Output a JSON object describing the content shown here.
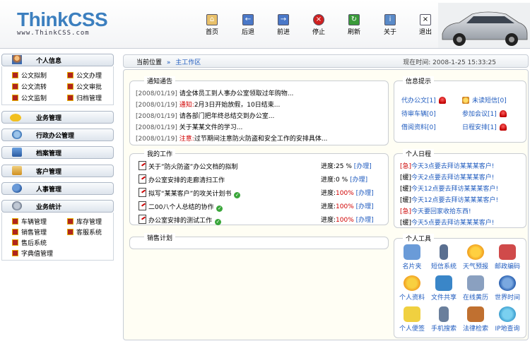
{
  "logo": {
    "main": "ThinkCSS",
    "sub": "www.ThinkCSS.com"
  },
  "toolbar": [
    {
      "label": "首页",
      "icon": "home-icon"
    },
    {
      "label": "后退",
      "icon": "back-arrow-icon"
    },
    {
      "label": "前进",
      "icon": "forward-arrow-icon"
    },
    {
      "label": "停止",
      "icon": "stop-icon"
    },
    {
      "label": "刷新",
      "icon": "refresh-icon"
    },
    {
      "label": "关于",
      "icon": "about-icon"
    },
    {
      "label": "退出",
      "icon": "exit-icon"
    }
  ],
  "sidebar": {
    "personal": {
      "title": "个人信息",
      "items": [
        "公文拟制",
        "公文办理",
        "公文流转",
        "公文审批",
        "公文监制",
        "归档管理"
      ]
    },
    "business": {
      "title": "业务管理"
    },
    "office": {
      "title": "行政办公管理"
    },
    "archive": {
      "title": "档案管理"
    },
    "customer": {
      "title": "客户管理"
    },
    "hr": {
      "title": "人事管理"
    },
    "stats": {
      "title": "业务统计",
      "items": [
        "车辆管理",
        "库存管理",
        "销售管理",
        "客服系统",
        "售后系统",
        "字典值管理"
      ]
    }
  },
  "crumb": {
    "label": "当前位置",
    "sep": "»",
    "current": "主工作区",
    "time_label": "现在时间:",
    "time": "2008-1-25 15:33:25"
  },
  "notice": {
    "title": "通知通告",
    "rows": [
      {
        "date": "[2008/01/19]",
        "flag": "",
        "text": "请全体员工到人事办公室领取过年购物..."
      },
      {
        "date": "[2008/01/19]",
        "flag": "通知:",
        "text": "2月3日开始放假，10日结束..."
      },
      {
        "date": "[2008/01/19]",
        "flag": "",
        "text": "请各部门把年终总结交到办公室..."
      },
      {
        "date": "[2008/01/19]",
        "flag": "",
        "text": "关于某某文件的学习..."
      },
      {
        "date": "[2008/01/19]",
        "flag": "注意:",
        "text": "过节期间注意防火防盗和安全工作的安排具体..."
      }
    ]
  },
  "work": {
    "title": "我的工作",
    "rows": [
      {
        "text": "关于”防火防盗”办公文档的拟制",
        "done": false,
        "progress_label": "进度:",
        "progress": "25 %",
        "action": "[办理]"
      },
      {
        "text": "办公室安排的走廊清扫工作",
        "done": false,
        "progress_label": "进度:",
        "progress": "0 %",
        "action": "[办理]"
      },
      {
        "text": "拟写“某某客户”的攻关计划书",
        "done": true,
        "progress_label": "进度:",
        "progress": "100%",
        "action": "[办理]"
      },
      {
        "text": "二00八个人总结的协作",
        "done": true,
        "progress_label": "进度:",
        "progress": "100%",
        "action": "[办理]"
      },
      {
        "text": "办公室安排的测试工作",
        "done": true,
        "progress_label": "进度:",
        "progress": "100%",
        "action": "[办理]"
      }
    ]
  },
  "sales": {
    "title": "销售计划"
  },
  "tips": {
    "title": "信息提示",
    "items": [
      {
        "label": "代办公文",
        "count": "[1]"
      },
      {
        "label": "未读短信",
        "count": "[0]"
      },
      {
        "label": "待审车辆",
        "count": "[0]"
      },
      {
        "label": "参加会议",
        "count": "[1]"
      },
      {
        "label": "借阅资料",
        "count": "[0]"
      },
      {
        "label": "日程安排",
        "count": "[1]"
      }
    ]
  },
  "schedule": {
    "title": "个人日程",
    "rows": [
      {
        "tag": "[急]",
        "urgent": true,
        "text": "今天3点要去拜访某某某客户!"
      },
      {
        "tag": "[缓]",
        "urgent": false,
        "text": "今天2点要去拜访某某某客户!"
      },
      {
        "tag": "[缓]",
        "urgent": false,
        "text": "今天12点要去拜访某某某客户!"
      },
      {
        "tag": "[缓]",
        "urgent": false,
        "text": "今天12点要去拜访某某某客户!"
      },
      {
        "tag": "[急]",
        "urgent": true,
        "text": "今天要回家收拾东西!"
      },
      {
        "tag": "[缓]",
        "urgent": false,
        "text": "今天5点要去拜访某某某客户!"
      }
    ]
  },
  "tools": {
    "title": "个人工具",
    "items": [
      {
        "label": "名片夹",
        "icon": "card-holder-icon",
        "color": "#6a9bd8"
      },
      {
        "label": "短信系统",
        "icon": "mobile-phone-icon",
        "color": "#5a6f90"
      },
      {
        "label": "天气预报",
        "icon": "weather-icon",
        "color": "#f0a020"
      },
      {
        "label": "邮政编码",
        "icon": "postcode-icon",
        "color": "#d04a4a"
      },
      {
        "label": "个人资料",
        "icon": "profile-icon",
        "color": "#f2b020"
      },
      {
        "label": "文件共享",
        "icon": "file-share-icon",
        "color": "#3a86c8"
      },
      {
        "label": "在线黄历",
        "icon": "calendar-icon",
        "color": "#8aa0c0"
      },
      {
        "label": "世界时间",
        "icon": "world-time-icon",
        "color": "#2a60b0"
      },
      {
        "label": "个人便签",
        "icon": "notepad-icon",
        "color": "#f0d040"
      },
      {
        "label": "手机搜索",
        "icon": "phone-search-icon",
        "color": "#6a7f9c"
      },
      {
        "label": "法律检索",
        "icon": "law-search-icon",
        "color": "#c07030"
      },
      {
        "label": "IP地查询",
        "icon": "ip-lookup-icon",
        "color": "#3ea0d0"
      }
    ]
  }
}
